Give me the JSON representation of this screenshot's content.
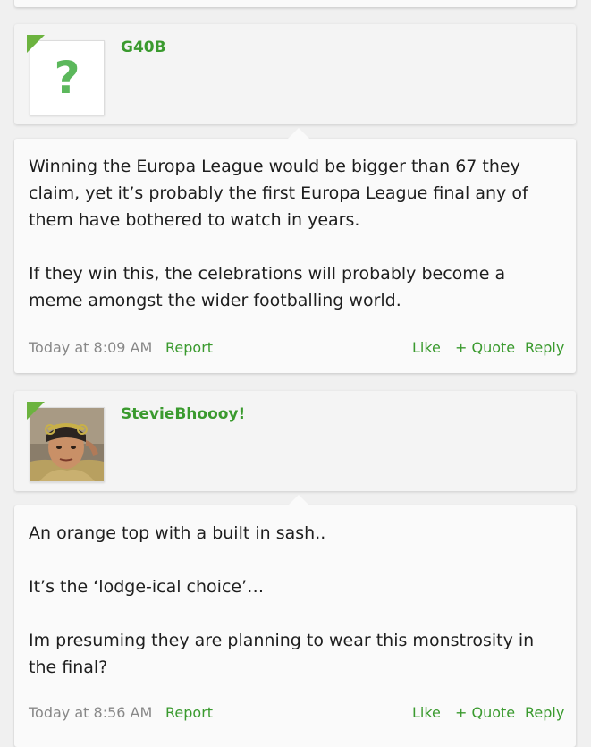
{
  "posts": [
    {
      "username": "G40B",
      "avatar_icon": "question-mark-icon",
      "paragraphs": [
        "Winning the Europa League would be bigger than 67 they claim, yet it’s probably the first Europa League final any of them have bothered to watch in years.",
        "If they win this, the celebrations will probably become a meme amongst the wider footballing world."
      ],
      "date": "Today at 8:09 AM",
      "report_label": "Report",
      "like_label": "Like",
      "quote_label": "+ Quote",
      "reply_label": "Reply"
    },
    {
      "username": "StevieBhoooy!",
      "avatar_icon": "monkey-king-avatar",
      "paragraphs": [
        "An orange top with a built in sash..",
        "It’s the ‘lodge-ical choice’…",
        "Im presuming they are planning to wear this monstrosity in the final?"
      ],
      "date": "Today at 8:56 AM",
      "report_label": "Report",
      "like_label": "Like",
      "quote_label": "+ Quote",
      "reply_label": "Reply"
    }
  ],
  "colors": {
    "accent_green": "#3a9a2e",
    "corner_green": "#6cb33f",
    "meta_gray": "#888888"
  }
}
